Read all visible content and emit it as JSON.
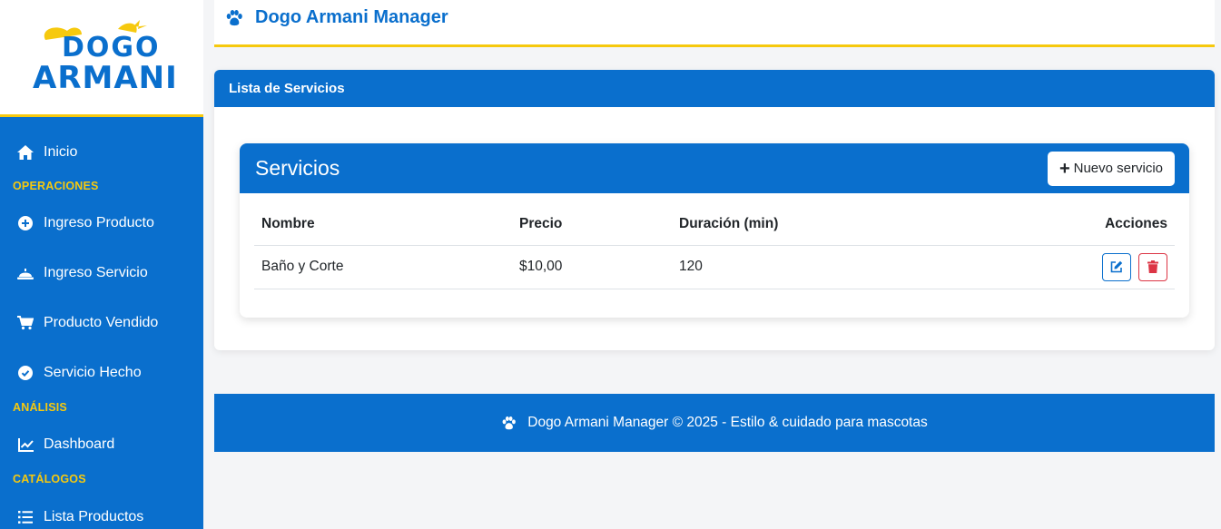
{
  "app": {
    "logo_line1": "DOGO",
    "logo_line2": "ARMANI",
    "header_title": "Dogo Armani Manager"
  },
  "sidebar": {
    "home": "Inicio",
    "sections": [
      {
        "title": "OPERACIONES",
        "items": [
          "Ingreso Producto",
          "Ingreso Servicio",
          "Producto Vendido",
          "Servicio Hecho"
        ]
      },
      {
        "title": "ANÁLISIS",
        "items": [
          "Dashboard"
        ]
      },
      {
        "title": "CATÁLOGOS",
        "items": [
          "Lista Productos"
        ]
      }
    ]
  },
  "page": {
    "card_title": "Lista de Servicios",
    "panel_title": "Servicios",
    "new_button": "Nuevo servicio",
    "columns": [
      "Nombre",
      "Precio",
      "Duración (min)",
      "Acciones"
    ],
    "rows": [
      {
        "nombre": "Baño y Corte",
        "precio": "$10,00",
        "duracion": "120"
      }
    ]
  },
  "footer": {
    "text": "Dogo Armani Manager © 2025 - Estilo & cuidado para mascotas"
  },
  "colors": {
    "primary": "#0a6fcd",
    "accent": "#f6c90e",
    "danger": "#dc3545"
  },
  "icons": {
    "header": "paw-icon",
    "nav": [
      "home-icon",
      "plus-circle-icon",
      "bell-icon",
      "cart-icon",
      "check-circle-icon",
      "chart-line-icon",
      "list-icon"
    ],
    "row_actions": [
      "edit-icon",
      "trash-icon"
    ]
  }
}
